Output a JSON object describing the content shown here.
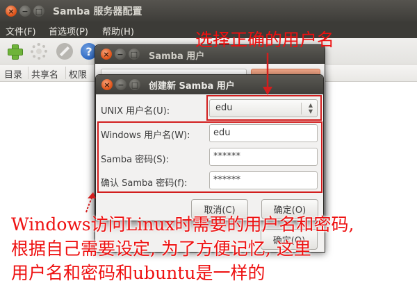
{
  "main_window": {
    "title": "Samba 服务器配置",
    "menu": [
      "文件(F)",
      "首选项(P)",
      "帮助(H)"
    ],
    "toolbar_icons": [
      "add-icon",
      "gear-icon",
      "stop-icon",
      "help-icon"
    ],
    "help_glyph": "?",
    "columns": [
      "目录",
      "共享名",
      "权限"
    ]
  },
  "users_dialog": {
    "title": "Samba 用户",
    "ok_button": "确定(O)"
  },
  "create_dialog": {
    "title": "创建新 Samba 用户",
    "unix_label": "UNIX 用户名(U):",
    "unix_value": "edu",
    "windows_label": "Windows 用户名(W):",
    "windows_value": "edu",
    "password_label": "Samba 密码(S):",
    "password_value": "******",
    "confirm_label": "确认 Samba 密码(f):",
    "confirm_value": "******",
    "cancel_button": "取消(C)",
    "ok_button": "确定(O)"
  },
  "annotations": {
    "top": "选择正确的用户名",
    "bottom_line1": "Windows访问Linux时需要的用户名和密码,",
    "bottom_line2": "根据自己需要设定, 为了方便记忆, 这里",
    "bottom_line3": "用户名和密码和ubuntu是一样的"
  },
  "colors": {
    "annotation_red": "#ee1010",
    "titlebar_dark": "#3e3d39",
    "close_button_orange": "#e2571d"
  }
}
